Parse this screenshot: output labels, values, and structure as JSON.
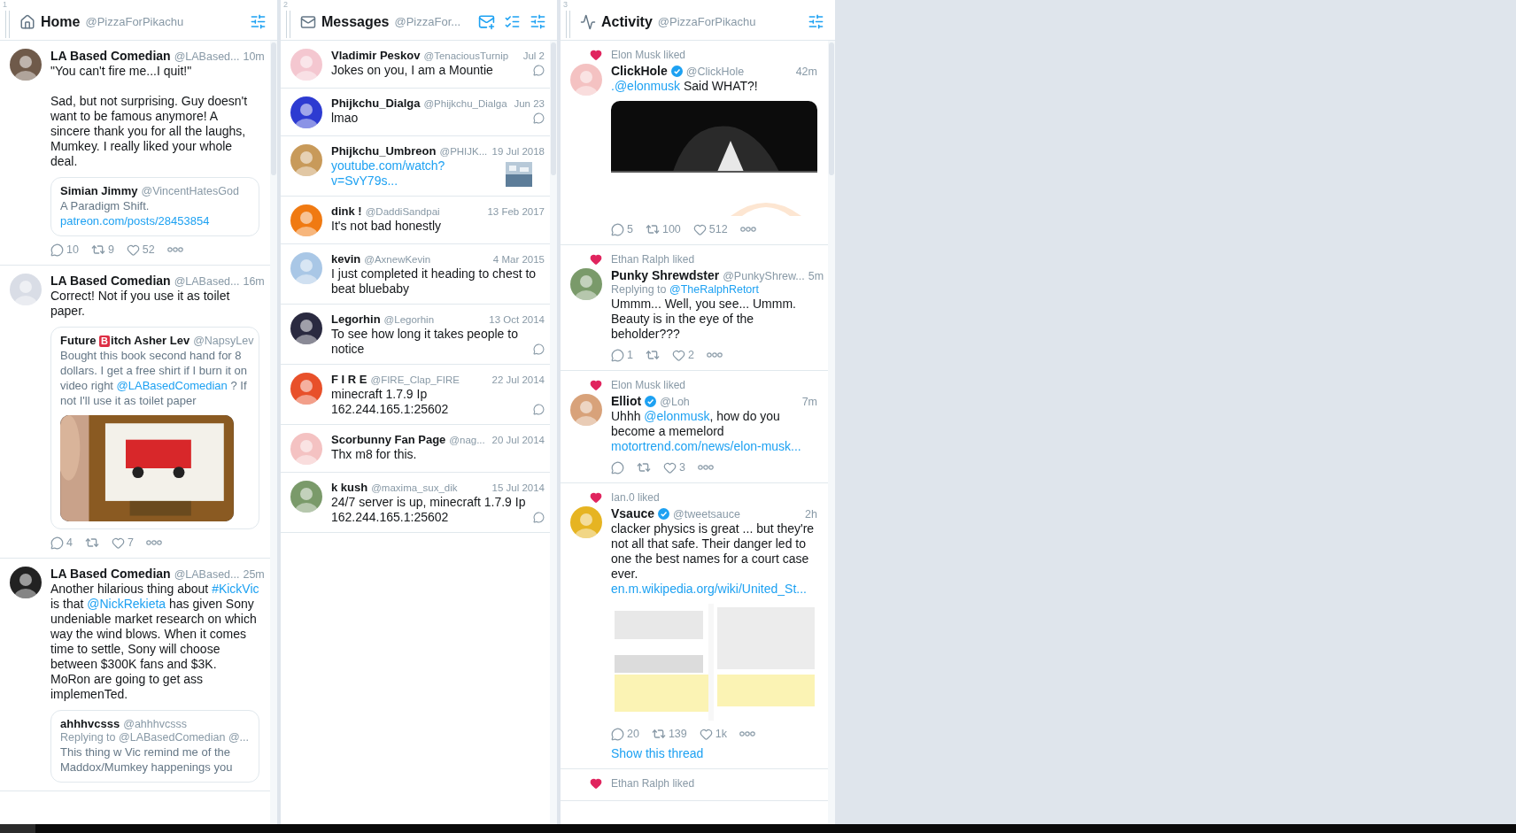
{
  "columns": [
    {
      "number": "1",
      "kind": "home",
      "title": "Home",
      "account": "@PizzaForPikachu",
      "actions": [
        {
          "kind": "filter"
        }
      ],
      "items": [
        {
          "name": "LA Based Comedian",
          "handle": "@LABased...",
          "time": "10m",
          "text": [
            {
              "text": "\"You can't fire me...I quit!\"\n\nSad, but not surprising. Guy doesn't want to be famous anymore! A sincere thank you for all the laughs, Mumkey. I really liked your whole deal.",
              "link": false
            }
          ],
          "quote": {
            "name": [
              {
                "text": "Simian Jimmy",
                "kind": "plain"
              }
            ],
            "handle": "@VincentHatesGod",
            "text": [
              {
                "text": "A Paradigm Shift. ",
                "link": false
              },
              {
                "text": "patreon.com/posts/28453854",
                "link": true
              }
            ]
          },
          "stats": {
            "replies": "10",
            "retweets": "9",
            "likes": "52"
          }
        },
        {
          "name": "LA Based Comedian",
          "handle": "@LABased...",
          "time": "16m",
          "text": [
            {
              "text": "Correct! Not if you use it as toilet paper.",
              "link": false
            }
          ],
          "quote": {
            "name": [
              {
                "text": "Future ",
                "kind": "plain"
              },
              {
                "text": "B",
                "kind": "emoji"
              },
              {
                "text": "itch Asher Lev",
                "kind": "plain"
              }
            ],
            "handle": "@NapsyLev",
            "text": [
              {
                "text": "Bought this book second hand for 8 dollars. I get a free shirt if I burn it on video right ",
                "link": false
              },
              {
                "text": "@LABasedComedian",
                "link": true
              },
              {
                "text": " ? If not I'll use it as toilet paper",
                "link": false
              }
            ],
            "media": {
              "kind": "picture"
            }
          },
          "stats": {
            "replies": "4",
            "likes": "7"
          }
        },
        {
          "name": "LA Based Comedian",
          "handle": "@LABased...",
          "time": "25m",
          "text": [
            {
              "text": "Another hilarious thing about ",
              "link": false
            },
            {
              "text": "#KickVic",
              "link": true
            },
            {
              "text": " is that ",
              "link": false
            },
            {
              "text": "@NickRekieta",
              "link": true
            },
            {
              "text": " has given Sony undeniable market research on which way the wind blows. When it comes time to settle, Sony will choose between $300K fans and $3K. MoRon are going to get ass implemenTed.",
              "link": false
            }
          ],
          "quote": {
            "name": [
              {
                "text": "ahhhvcsss",
                "kind": "plain"
              }
            ],
            "handle": "@ahhhvcsss",
            "replying": {
              "label": "Replying to",
              "users": "@LABasedComedian @...",
              "link": false
            },
            "text": [
              {
                "text": "This thing w Vic remind me of the Maddox/Mumkey happenings you",
                "link": false
              }
            ]
          }
        }
      ]
    },
    {
      "number": "2",
      "kind": "messages",
      "title": "Messages",
      "account": "@PizzaFor...",
      "actions": [
        {
          "kind": "compose"
        },
        {
          "kind": "mark_read"
        },
        {
          "kind": "filter"
        }
      ],
      "items": [
        {
          "name": "Vladimir Peskov",
          "handle": "@TenaciousTurnip",
          "date": "Jul 2",
          "text": "Jokes on you, I am a Mountie",
          "link": false,
          "replied": true
        },
        {
          "name": "Phijkchu_Dialga",
          "handle": "@Phijkchu_Dialga",
          "date": "Jun 23",
          "text": "lmao",
          "link": false,
          "replied": true
        },
        {
          "name": "Phijkchu_Umbreon",
          "handle": "@PHIJK...",
          "date": "19 Jul 2018",
          "text": "youtube.com/watch?v=SvY79s...",
          "link": true,
          "replied": false,
          "attachment": {
            "kind": "picture"
          }
        },
        {
          "name": "dink !",
          "handle": "@DaddiSandpai",
          "date": "13 Feb 2017",
          "text": "It's not bad honestly",
          "link": false,
          "replied": false
        },
        {
          "name": "kevin",
          "handle": "@AxnewKevin",
          "date": "4 Mar 2015",
          "text": "I just completed it heading to chest to beat bluebaby",
          "link": false,
          "replied": false
        },
        {
          "name": "Legorhin",
          "handle": "@Legorhin",
          "date": "13 Oct 2014",
          "text": "To see how long it takes people to notice",
          "link": false,
          "replied": true
        },
        {
          "name": "F I R E",
          "handle": "@FIRE_Clap_FIRE",
          "date": "22 Jul 2014",
          "text": "minecraft 1.7.9 Ip 162.244.165.1:25602",
          "link": false,
          "replied": true
        },
        {
          "name": "Scorbunny Fan Page",
          "handle": "@nag...",
          "date": "20 Jul 2014",
          "text": "Thx m8 for this.",
          "link": false,
          "replied": false
        },
        {
          "name": "k kush",
          "handle": "@maxima_sux_dik",
          "date": "15 Jul 2014",
          "text": "24/7 server is up, minecraft 1.7.9 Ip 162.244.165.1:25602",
          "link": false,
          "replied": true
        }
      ]
    },
    {
      "number": "3",
      "kind": "activity",
      "title": "Activity",
      "account": "@PizzaForPikachu",
      "actions": [
        {
          "kind": "filter"
        }
      ],
      "items": [
        {
          "liked_by": "Elon Musk liked",
          "name": "ClickHole",
          "verified": true,
          "handle": "@ClickHole",
          "time": "42m",
          "text": [
            {
              "text": ".@elonmusk",
              "link": true
            },
            {
              "text": " Said WHAT?!",
              "link": false
            }
          ],
          "media": {
            "kind": "picture"
          },
          "stats": {
            "replies": "5",
            "retweets": "100",
            "likes": "512"
          }
        },
        {
          "liked_by": "Ethan Ralph liked",
          "name": "Punky Shrewdster",
          "verified": false,
          "handle": "@PunkyShrew...",
          "time": "5m",
          "replying": {
            "label": "Replying to",
            "users": "@TheRalphRetort",
            "link": true
          },
          "text": [
            {
              "text": "Ummm... Well, you see... Ummm. Beauty is in the eye of the beholder???",
              "link": false
            }
          ],
          "stats": {
            "replies": "1",
            "likes": "2"
          }
        },
        {
          "liked_by": "Elon Musk liked",
          "name": "Elliot",
          "verified": true,
          "handle": "@Loh",
          "time": "7m",
          "text": [
            {
              "text": "Uhhh ",
              "link": false
            },
            {
              "text": "@elonmusk",
              "link": true
            },
            {
              "text": ", how do you become a memelord ",
              "link": false
            },
            {
              "text": "motortrend.com/news/elon-musk...",
              "link": true
            }
          ],
          "stats": {
            "likes": "3"
          }
        },
        {
          "liked_by": "Ian.0 liked",
          "name": "Vsauce",
          "verified": true,
          "handle": "@tweetsauce",
          "time": "2h",
          "text": [
            {
              "text": "clacker physics is great ... but they're not all that safe. Their danger led to one the best names for a court case ever. ",
              "link": false
            },
            {
              "text": "en.m.wikipedia.org/wiki/United_St...",
              "link": true
            }
          ],
          "media": {
            "kind": "picture"
          },
          "stats": {
            "replies": "20",
            "retweets": "139",
            "likes": "1k"
          },
          "thread": "Show this thread"
        },
        {
          "liked_by": "Ethan Ralph liked"
        }
      ]
    }
  ]
}
